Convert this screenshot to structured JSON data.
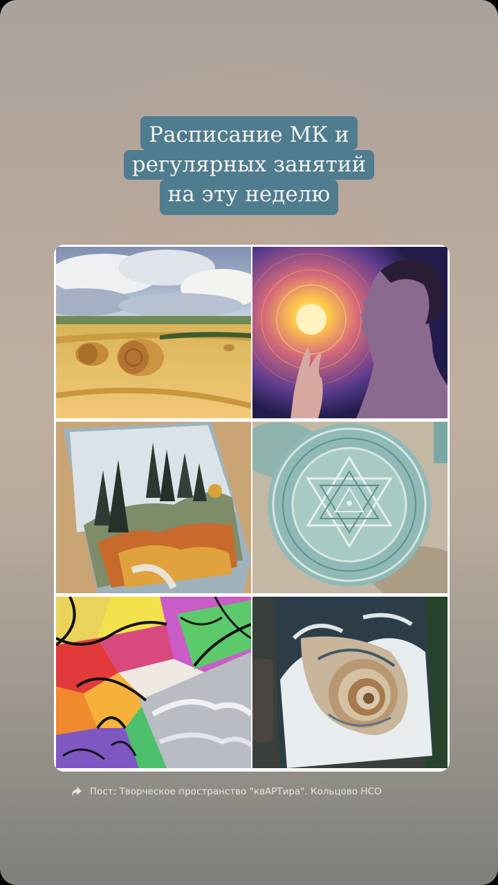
{
  "story": {
    "title_lines": [
      "Расписание МК и",
      "регулярных занятий",
      "на эту неделю"
    ],
    "credit_text": "Пост: Творческое пространство \"квАРТира\". Кольцово НСО",
    "credit_icon": "share-arrow-icon"
  },
  "gallery": {
    "images": [
      {
        "subject": "hay bales field landscape painting"
      },
      {
        "subject": "meditating woman with glowing light painting"
      },
      {
        "subject": "autumn forest pastel landscape"
      },
      {
        "subject": "textured sri yantra mandala painting"
      },
      {
        "subject": "colorful neurographic drawing"
      },
      {
        "subject": "textured ammonite shell painting"
      }
    ]
  }
}
